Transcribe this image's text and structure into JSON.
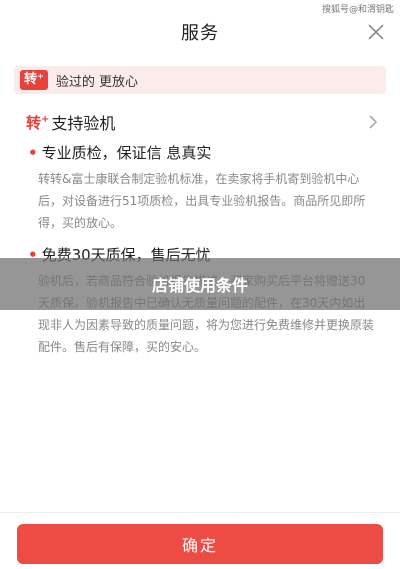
{
  "watermark": "搜狐号@和渭钥匙",
  "header": {
    "title": "服务"
  },
  "banner": {
    "badge": "转⁺",
    "text": "验过的 更放心"
  },
  "card": {
    "logo": "转",
    "logo_sup": "+",
    "title": "支持验机",
    "sections": [
      {
        "heading": "专业质检，保证信 息真实",
        "body": "转转&富士康联合制定验机标准，在卖家将手机寄到验机中心后，对设备进行51项质检，出具专业验机报告。商品所见即所得，买的放心。"
      },
      {
        "heading": "免费30天质保，售后无忧",
        "body": "验机后，若商品符合验机报告描述，买家购买后平台将赠送30天质保。验机报告中已确认无质量问题的配件，在30天内如出现非人为因素导致的质量问题，将为您进行免费维修并更换原装配件。售后有保障，买的安心。"
      }
    ]
  },
  "overlay": {
    "text": "店铺使用条件"
  },
  "footer": {
    "confirm_label": "确定"
  }
}
